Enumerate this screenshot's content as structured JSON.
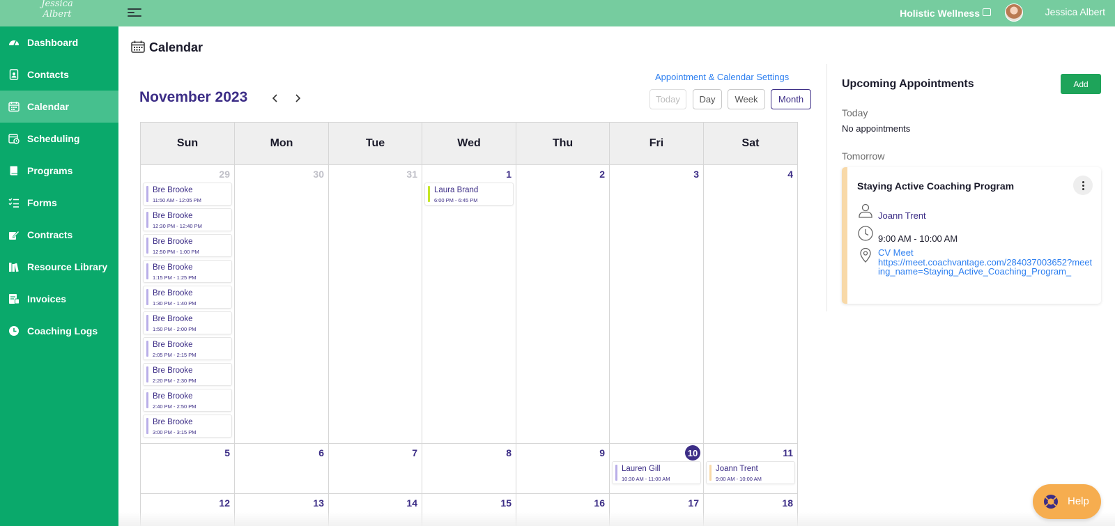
{
  "topbar": {
    "logo_text": "Jessica Albert",
    "org_name": "Holistic Wellness",
    "user_name": "Jessica Albert"
  },
  "sidebar": {
    "items": [
      {
        "label": "Dashboard",
        "icon": "dashboard-icon"
      },
      {
        "label": "Contacts",
        "icon": "contacts-icon"
      },
      {
        "label": "Calendar",
        "icon": "calendar-icon",
        "active": true
      },
      {
        "label": "Scheduling",
        "icon": "scheduling-icon"
      },
      {
        "label": "Programs",
        "icon": "programs-icon"
      },
      {
        "label": "Forms",
        "icon": "forms-icon"
      },
      {
        "label": "Contracts",
        "icon": "contracts-icon"
      },
      {
        "label": "Resource Library",
        "icon": "library-icon"
      },
      {
        "label": "Invoices",
        "icon": "invoices-icon"
      },
      {
        "label": "Coaching Logs",
        "icon": "clock-icon"
      }
    ]
  },
  "page": {
    "title": "Calendar"
  },
  "calendar": {
    "settings_link": "Appointment & Calendar Settings",
    "month_label": "November 2023",
    "views": {
      "today": "Today",
      "day": "Day",
      "week": "Week",
      "month": "Month"
    },
    "active_view": "Month",
    "weekdays": [
      "Sun",
      "Mon",
      "Tue",
      "Wed",
      "Thu",
      "Fri",
      "Sat"
    ],
    "weeks": [
      [
        {
          "day": "29",
          "muted": true,
          "events": [
            {
              "name": "Bre Brooke",
              "time": "11:50 AM - 12:05 PM",
              "color": "#b9aee8"
            },
            {
              "name": "Bre Brooke",
              "time": "12:30 PM - 12:40 PM",
              "color": "#b9aee8"
            },
            {
              "name": "Bre Brooke",
              "time": "12:50 PM - 1:00 PM",
              "color": "#b9aee8"
            },
            {
              "name": "Bre Brooke",
              "time": "1:15 PM - 1:25 PM",
              "color": "#b9aee8"
            },
            {
              "name": "Bre Brooke",
              "time": "1:30 PM - 1:40 PM",
              "color": "#b9aee8"
            },
            {
              "name": "Bre Brooke",
              "time": "1:50 PM - 2:00 PM",
              "color": "#b9aee8"
            },
            {
              "name": "Bre Brooke",
              "time": "2:05 PM - 2:15 PM",
              "color": "#b9aee8"
            },
            {
              "name": "Bre Brooke",
              "time": "2:20 PM - 2:30 PM",
              "color": "#b9aee8"
            },
            {
              "name": "Bre Brooke",
              "time": "2:40 PM - 2:50 PM",
              "color": "#b9aee8"
            },
            {
              "name": "Bre Brooke",
              "time": "3:00 PM - 3:15 PM",
              "color": "#b9aee8"
            }
          ]
        },
        {
          "day": "30",
          "muted": true,
          "events": []
        },
        {
          "day": "31",
          "muted": true,
          "events": []
        },
        {
          "day": "1",
          "events": [
            {
              "name": "Laura Brand",
              "time": "6:00 PM - 6:45 PM",
              "color": "#c5e627"
            }
          ]
        },
        {
          "day": "2",
          "events": []
        },
        {
          "day": "3",
          "events": []
        },
        {
          "day": "4",
          "events": []
        }
      ],
      [
        {
          "day": "5",
          "events": []
        },
        {
          "day": "6",
          "events": []
        },
        {
          "day": "7",
          "events": []
        },
        {
          "day": "8",
          "events": []
        },
        {
          "day": "9",
          "events": []
        },
        {
          "day": "10",
          "today": true,
          "events": [
            {
              "name": "Lauren Gill",
              "time": "10:30 AM - 11:00 AM",
              "color": "#b9aee8"
            }
          ]
        },
        {
          "day": "11",
          "events": [
            {
              "name": "Joann Trent",
              "time": "9:00 AM - 10:00 AM",
              "color": "#f8d9a8"
            }
          ]
        }
      ],
      [
        {
          "day": "12",
          "events": []
        },
        {
          "day": "13",
          "events": []
        },
        {
          "day": "14",
          "events": []
        },
        {
          "day": "15",
          "events": []
        },
        {
          "day": "16",
          "events": []
        },
        {
          "day": "17",
          "events": []
        },
        {
          "day": "18",
          "events": []
        }
      ]
    ]
  },
  "upcoming": {
    "title": "Upcoming Appointments",
    "add_label": "Add",
    "today_label": "Today",
    "today_empty": "No appointments",
    "tomorrow_label": "Tomorrow",
    "appointment": {
      "title": "Staying Active Coaching Program",
      "person": "Joann Trent",
      "time": "9:00 AM - 10:00 AM",
      "location_name": "CV Meet",
      "location_url": "https://meet.coachvantage.com/284037003652?meeting_name=Staying_Active_Coaching_Program_",
      "accent_color": "#f8d9a8"
    }
  },
  "help": {
    "label": "Help"
  },
  "colors": {
    "topbar": "#76cc9f",
    "sidebar": "#0aa96b",
    "sidebar_active": "#46c08e",
    "primary_text": "#3c2d86",
    "link": "#2d7ff0",
    "add_button": "#1ea45a",
    "help_button": "#f6ad4f"
  }
}
